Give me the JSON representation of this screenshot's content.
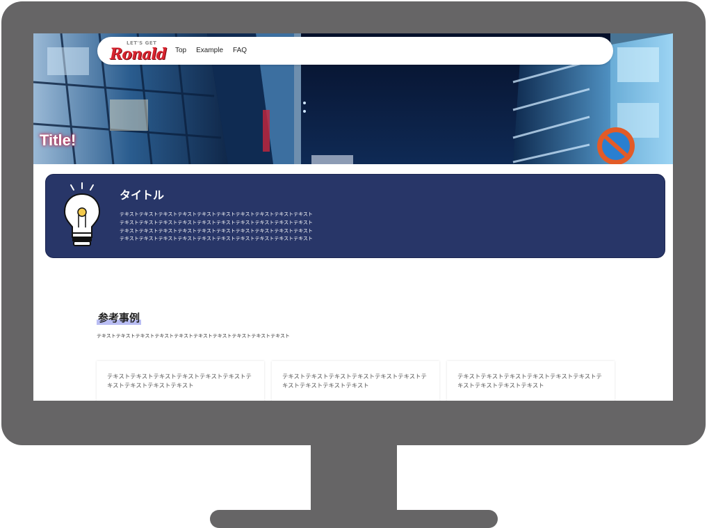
{
  "header": {
    "logo_small": "LET'S GET",
    "logo_text": "Ronald",
    "nav": [
      "Top",
      "Example",
      "FAQ"
    ]
  },
  "hero": {
    "title": "Title!"
  },
  "info_card": {
    "title": "タイトル",
    "lines": [
      "テキストテキストテキストテキストテキストテキストテキストテキストテキストテキスト",
      "テキストテキストテキストテキストテキストテキストテキストテキストテキストテキスト",
      "テキストテキストテキストテキストテキストテキストテキストテキストテキストテキスト",
      "テキストテキストテキストテキストテキストテキストテキストテキストテキストテキスト"
    ],
    "icon": "lightbulb-icon"
  },
  "section": {
    "title": "参考事例",
    "text": "テキストテキストテキストテキストテキストテキストテキストテキストテキストテキスト"
  },
  "cases": [
    {
      "text": "テキストテキストテキストテキストテキストテキストテキストテキストテキストテキスト"
    },
    {
      "text": "テキストテキストテキストテキストテキストテキストテキストテキストテキストテキスト"
    },
    {
      "text": "テキストテキストテキストテキストテキストテキストテキストテキストテキストテキスト"
    }
  ],
  "colors": {
    "frame": "#666566",
    "card_bg": "#283668",
    "logo": "#d8242f",
    "highlight": "#b9bdf3"
  }
}
